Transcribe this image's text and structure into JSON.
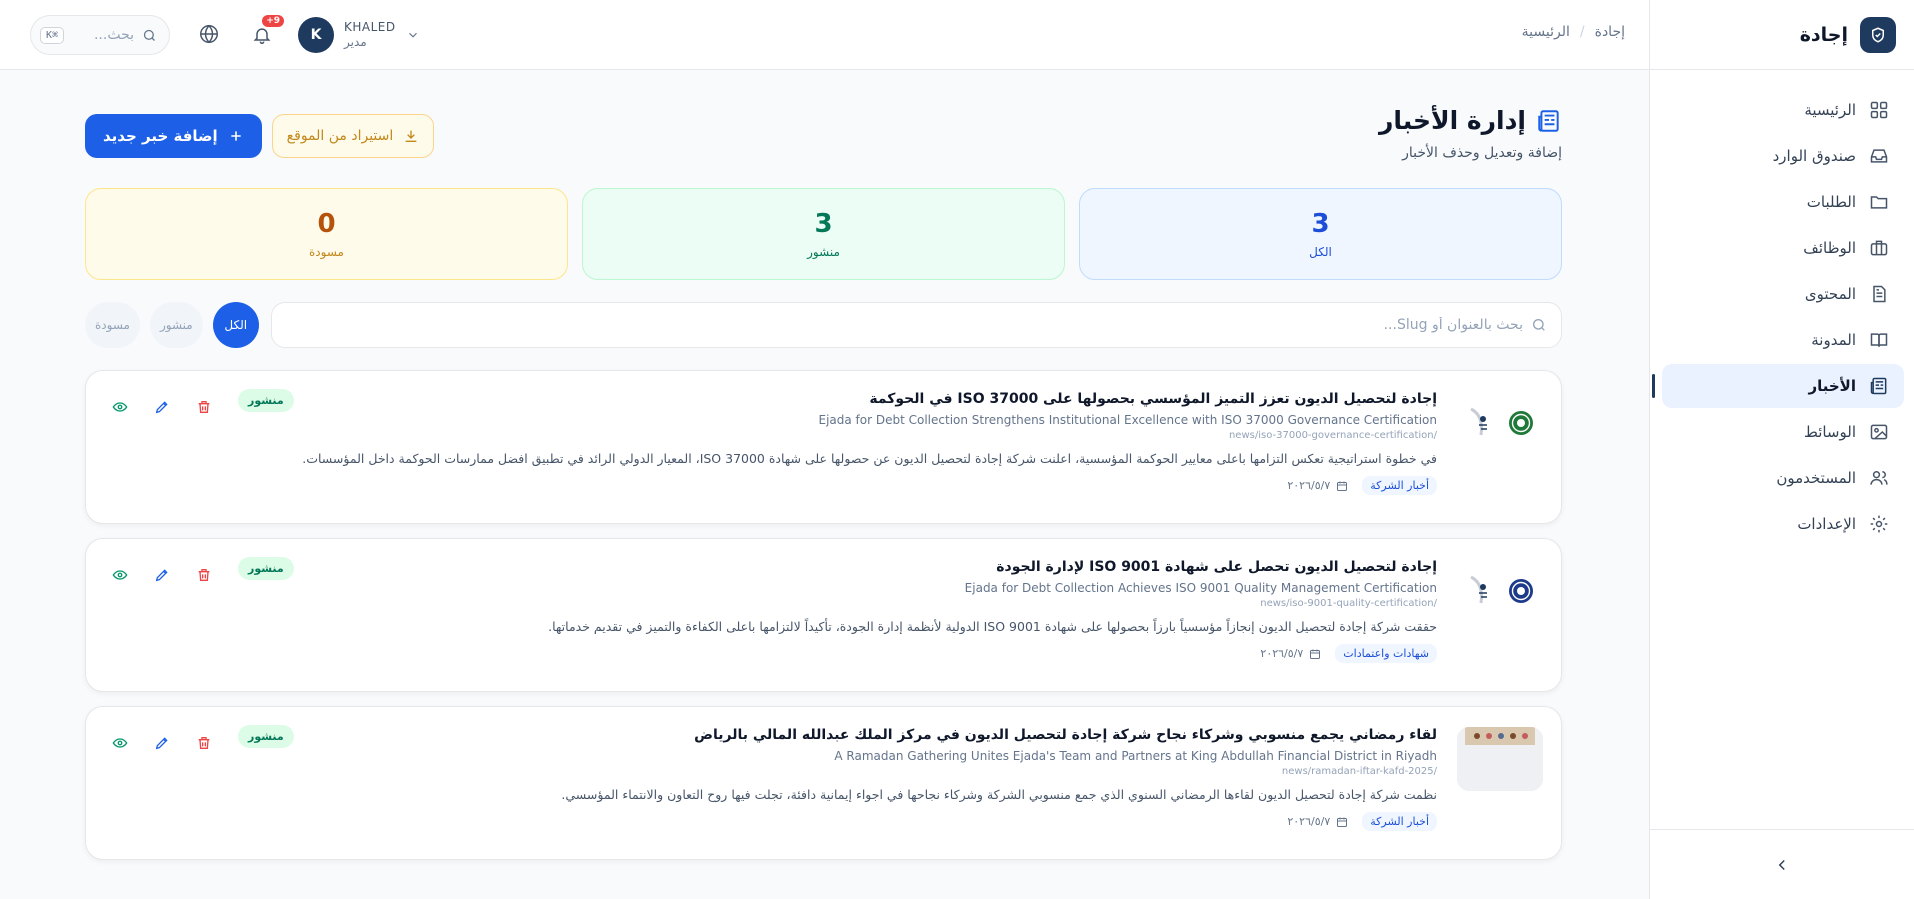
{
  "app": {
    "brand_name": "إجادة"
  },
  "breadcrumb": {
    "root": "إجادة",
    "current": "الرئيسية",
    "separator": "/"
  },
  "topbar": {
    "search_placeholder": "بحث...",
    "shortcut": "⌘K",
    "notification_count": "9+",
    "user": {
      "initial": "K",
      "name": "KHALED",
      "role": "مدير"
    }
  },
  "sidebar": {
    "items": [
      {
        "label": "الرئيسية",
        "icon": "grid-icon"
      },
      {
        "label": "صندوق الوارد",
        "icon": "inbox-icon"
      },
      {
        "label": "الطلبات",
        "icon": "folder-icon"
      },
      {
        "label": "الوظائف",
        "icon": "briefcase-icon"
      },
      {
        "label": "المحتوى",
        "icon": "document-icon"
      },
      {
        "label": "المدونة",
        "icon": "book-icon"
      },
      {
        "label": "الأخبار",
        "icon": "newspaper-icon",
        "active": true
      },
      {
        "label": "الوسائط",
        "icon": "image-icon"
      },
      {
        "label": "المستخدمون",
        "icon": "users-icon"
      },
      {
        "label": "الإعدادات",
        "icon": "gear-icon"
      }
    ]
  },
  "page": {
    "title": "إدارة الأخبار",
    "subtitle": "إضافة وتعديل وحذف الأخبار",
    "add_button": "إضافة خبر جديد",
    "import_button": "استيراد من الموقع"
  },
  "stats": {
    "all": {
      "value": "3",
      "label": "الكل"
    },
    "published": {
      "value": "3",
      "label": "منشور"
    },
    "draft": {
      "value": "0",
      "label": "مسودة"
    }
  },
  "filters": {
    "search_placeholder": "بحث بالعنوان أو Slug...",
    "chips": [
      "الكل",
      "منشور",
      "مسودة"
    ]
  },
  "news": [
    {
      "title": "إجادة لتحصيل الديون تعزز التميز المؤسسي بحصولها على ISO 37000 في الحوكمة",
      "title_en": "Ejada for Debt Collection Strengthens Institutional Excellence with ISO 37000 Governance Certification",
      "slug": "/news/iso-37000-governance-certification",
      "excerpt": "في خطوة استراتيجية تعكس التزامها باعلى معايير الحوكمة المؤسسية، اعلنت شركة إجادة لتحصيل الديون عن حصولها على شهادة ISO 37000، المعيار الدولي الرائد في تطبيق افضل ممارسات الحوكمة داخل المؤسسات.",
      "category": "أخبار الشركة",
      "date": "٢٠٢٦/٥/٧",
      "status": "منشور"
    },
    {
      "title": "إجادة لتحصيل الديون تحصل على شهادة ISO 9001 لإدارة الجودة",
      "title_en": "Ejada for Debt Collection Achieves ISO 9001 Quality Management Certification",
      "slug": "/news/iso-9001-quality-certification",
      "excerpt": "حققت شركة إجادة لتحصيل الديون إنجازاً مؤسسياً بارزاً بحصولها على شهادة ISO 9001 الدولية لأنظمة إدارة الجودة، تأكيداً لالتزامها باعلى الكفاءة والتميز في تقديم خدماتها.",
      "category": "شهادات واعتمادات",
      "date": "٢٠٢٦/٥/٧",
      "status": "منشور"
    },
    {
      "title": "لقاء رمضاني يجمع منسوبي وشركاء نجاح شركة إجادة لتحصيل الديون في مركز الملك عبدالله المالي بالرياض",
      "title_en": "A Ramadan Gathering Unites Ejada's Team and Partners at King Abdullah Financial District in Riyadh",
      "slug": "/news/ramadan-iftar-kafd-2025",
      "excerpt": "نظمت شركة إجادة لتحصيل الديون لقاءها الرمضاني السنوي الذي جمع منسوبي الشركة وشركاء نجاحها في اجواء إيمانية دافئة، تجلت فيها روح التعاون والانتماء المؤسسي.",
      "category": "أخبار الشركة",
      "date": "٢٠٢٦/٥/٧",
      "status": "منشور"
    }
  ],
  "colors": {
    "primary": "#1d5fe6",
    "navy": "#1e3a5f",
    "published_green": "#047857",
    "draft_amber": "#b45309",
    "delete_red": "#ef4444"
  }
}
